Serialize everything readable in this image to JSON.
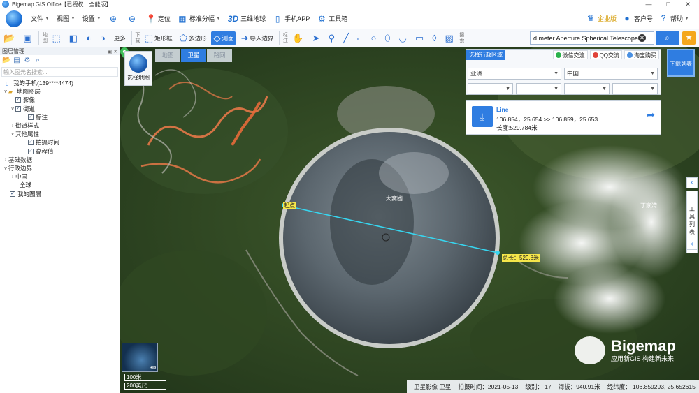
{
  "app": {
    "title": "Bigemap GIS Office【已授权：全能版】",
    "window_controls": {
      "minimize": "—",
      "maximize": "□",
      "close": "✕"
    }
  },
  "menu": {
    "file": "文件",
    "view": "视图",
    "settings": "设置",
    "locate": "定位",
    "standard_grid": "标准分幅",
    "globe3d_icon": "3D",
    "globe3d": "三维地球",
    "mobile_app": "手机APP",
    "toolbox": "工具箱",
    "enterprise": "企业版",
    "customer": "客户号",
    "help": "帮助"
  },
  "toolbar": {
    "map_label": "地图",
    "more": "更多",
    "download_label": "下载",
    "rect_box": "矩形框",
    "polygon": "多边形",
    "measure": "测面",
    "import_boundary": "导入边界",
    "mark_label": "标注",
    "search_label": "搜索",
    "search_value": "d meter Aperture Spherical Telescope"
  },
  "layer_panel": {
    "title": "图层管理",
    "search_placeholder": "输入图元名搜索...",
    "nodes": [
      {
        "label": "我的手机(139****4474)"
      },
      {
        "label": "地图图层"
      },
      {
        "label": "影像"
      },
      {
        "label": "街道"
      },
      {
        "label": "标注"
      },
      {
        "label": "街道样式"
      },
      {
        "label": "其他属性"
      },
      {
        "label": "拍摄时间"
      },
      {
        "label": "高程值"
      },
      {
        "label": "基础数据"
      },
      {
        "label": "行政边界"
      },
      {
        "label": "中国"
      },
      {
        "label": "全球"
      },
      {
        "label": "我的图层"
      }
    ]
  },
  "map": {
    "select_map": "选择地图",
    "tabs": [
      "地图",
      "卫星",
      "路网"
    ],
    "active_tab": "卫星",
    "place_label": "大窝凼",
    "right_place_label": "丁家湾",
    "start_label": "起点",
    "total_length_label": "总长：529.8米",
    "next_list": "下载列表",
    "tool_list": "工具列表",
    "overview_3d": "3D",
    "scale_top": "100米",
    "scale_bottom": "200英尺"
  },
  "admin_panel": {
    "tab": "选择行政区域",
    "wechat": "微信交流",
    "qq": "QQ交流",
    "taobao": "淘宝购买",
    "continent": "亚洲",
    "country": "中国"
  },
  "line_info": {
    "title": "Line",
    "coords": "106.854，25.654 >> 106.859，25.653",
    "length": "长度:529.784米"
  },
  "statusbar": {
    "source": "卫星影像 卫星",
    "date": "拍摄时间：2021-05-13",
    "level": "级别： 17",
    "elevation": "海拔：940.91米",
    "lonlat": "经纬度： 106.859293, 25.652615"
  },
  "brand": {
    "name": "Bigemap",
    "slogan": "应用新GIS  构建新未来"
  },
  "colors": {
    "accent": "#2f7de1",
    "measure_line": "#37d6f0",
    "road": "#f07a4a"
  },
  "icons": [
    "app-logo-icon",
    "locate-icon",
    "grid-icon",
    "phone-icon",
    "gear-icon",
    "search-icon",
    "star-icon",
    "hand-icon",
    "pointer-icon",
    "marker-icon",
    "line-icon",
    "circle-icon",
    "rect-icon"
  ]
}
